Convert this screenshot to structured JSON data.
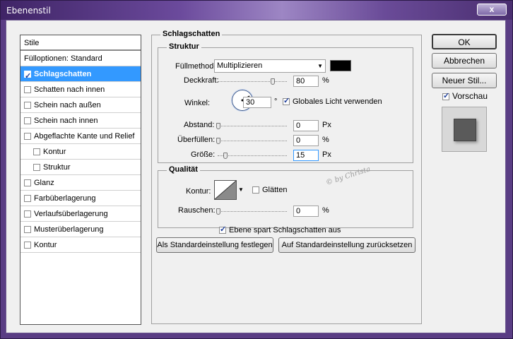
{
  "window": {
    "title": "Ebenenstil",
    "close_label": "x"
  },
  "styles_panel": {
    "header": "Stile",
    "items": [
      {
        "label": "Fülloptionen: Standard",
        "checkbox": false,
        "checked": false,
        "indent": false,
        "selected": false
      },
      {
        "label": "Schlagschatten",
        "checkbox": true,
        "checked": true,
        "indent": false,
        "selected": true
      },
      {
        "label": "Schatten nach innen",
        "checkbox": true,
        "checked": false,
        "indent": false,
        "selected": false
      },
      {
        "label": "Schein nach außen",
        "checkbox": true,
        "checked": false,
        "indent": false,
        "selected": false
      },
      {
        "label": "Schein nach innen",
        "checkbox": true,
        "checked": false,
        "indent": false,
        "selected": false
      },
      {
        "label": "Abgeflachte Kante und Relief",
        "checkbox": true,
        "checked": false,
        "indent": false,
        "selected": false
      },
      {
        "label": "Kontur",
        "checkbox": true,
        "checked": false,
        "indent": true,
        "selected": false
      },
      {
        "label": "Struktur",
        "checkbox": true,
        "checked": false,
        "indent": true,
        "selected": false
      },
      {
        "label": "Glanz",
        "checkbox": true,
        "checked": false,
        "indent": false,
        "selected": false
      },
      {
        "label": "Farbüberlagerung",
        "checkbox": true,
        "checked": false,
        "indent": false,
        "selected": false
      },
      {
        "label": "Verlaufsüberlagerung",
        "checkbox": true,
        "checked": false,
        "indent": false,
        "selected": false
      },
      {
        "label": "Musterüberlagerung",
        "checkbox": true,
        "checked": false,
        "indent": false,
        "selected": false
      },
      {
        "label": "Kontur",
        "checkbox": true,
        "checked": false,
        "indent": false,
        "selected": false
      }
    ]
  },
  "drop_shadow": {
    "section_title": "Schlagschatten",
    "structure": {
      "title": "Struktur",
      "blend_mode_label": "Füllmethode:",
      "blend_mode_value": "Multiplizieren",
      "shadow_color": "#000000",
      "opacity_label": "Deckkraft:",
      "opacity_value": "80",
      "opacity_unit": "%",
      "opacity_level": 0.8,
      "angle_label": "Winkel:",
      "angle_value": "30",
      "angle_unit": "°",
      "global_light_label": "Globales Licht verwenden",
      "global_light_checked": true,
      "distance_label": "Abstand:",
      "distance_value": "0",
      "distance_unit": "Px",
      "spread_label": "Überfüllen:",
      "spread_value": "0",
      "spread_unit": "%",
      "size_label": "Größe:",
      "size_value": "15",
      "size_unit": "Px"
    },
    "quality": {
      "title": "Qualität",
      "contour_label": "Kontur:",
      "antialias_label": "Glätten",
      "antialias_checked": false,
      "noise_label": "Rauschen:",
      "noise_value": "0",
      "noise_unit": "%"
    },
    "knockout_label": "Ebene spart Schlagschatten aus",
    "knockout_checked": true,
    "make_default_label": "Als Standardeinstellung festlegen",
    "reset_default_label": "Auf Standardeinstellung zurücksetzen"
  },
  "watermark": "© by Christa",
  "buttons": {
    "ok": "OK",
    "cancel": "Abbrechen",
    "new_style": "Neuer Stil...",
    "preview_label": "Vorschau",
    "preview_checked": true
  }
}
